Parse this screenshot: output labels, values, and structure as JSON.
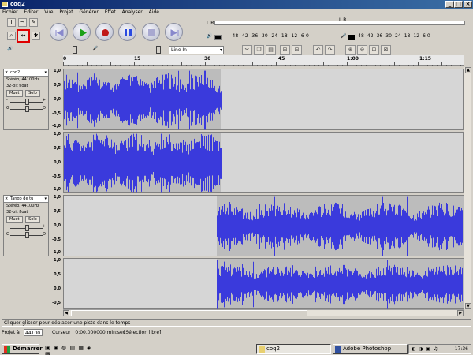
{
  "window": {
    "title": "coq2",
    "min": "_",
    "max": "□",
    "close": "×"
  },
  "menu": [
    "Fichier",
    "Editer",
    "Vue",
    "Projet",
    "Générer",
    "Effet",
    "Analyser",
    "Aide"
  ],
  "meters": {
    "labels": "-48 -42 -36 -30 -24 -18 -12 -6 0",
    "labels2": "-48 -42 -36 -30 -24 -18 -12 -6 0",
    "out_channels": "L R",
    "in_channels": "L R"
  },
  "input_source": {
    "value": "Line In"
  },
  "ruler": {
    "ticks": [
      "0",
      "15",
      "30",
      "45",
      "1:00",
      "1:15"
    ]
  },
  "vscale": [
    "1,0",
    "0,5",
    "0,0",
    "-0,5",
    "-1,0"
  ],
  "tracks": [
    {
      "name": "coq2",
      "rate": "Stéréo, 44100Hz",
      "format": "32-bit float",
      "mute": "Muet",
      "solo": "Solo",
      "pan_left": "G",
      "pan_right": "D"
    },
    {
      "name": "Tango de tu",
      "rate": "Stéréo, 44100Hz",
      "format": "32-bit float",
      "mute": "Muet",
      "solo": "Solo",
      "pan_left": "G",
      "pan_right": "D"
    }
  ],
  "status": {
    "text": "Cliquer-glisser pour déplacer une piste dans le temps"
  },
  "project": {
    "rate_label": "Projet à",
    "rate_value": "44100",
    "cursor": "Curseur : 0:00.000000 min:sec",
    "selection": "[Sélection libre]"
  },
  "taskbar": {
    "start": "Démarrer",
    "items": [
      "coq2",
      "Adobe Photoshop"
    ],
    "clock": "17:36"
  },
  "colors": {
    "wave": "#3a3adc",
    "accent": "#0a246a",
    "tool_highlight": "#e00000"
  }
}
